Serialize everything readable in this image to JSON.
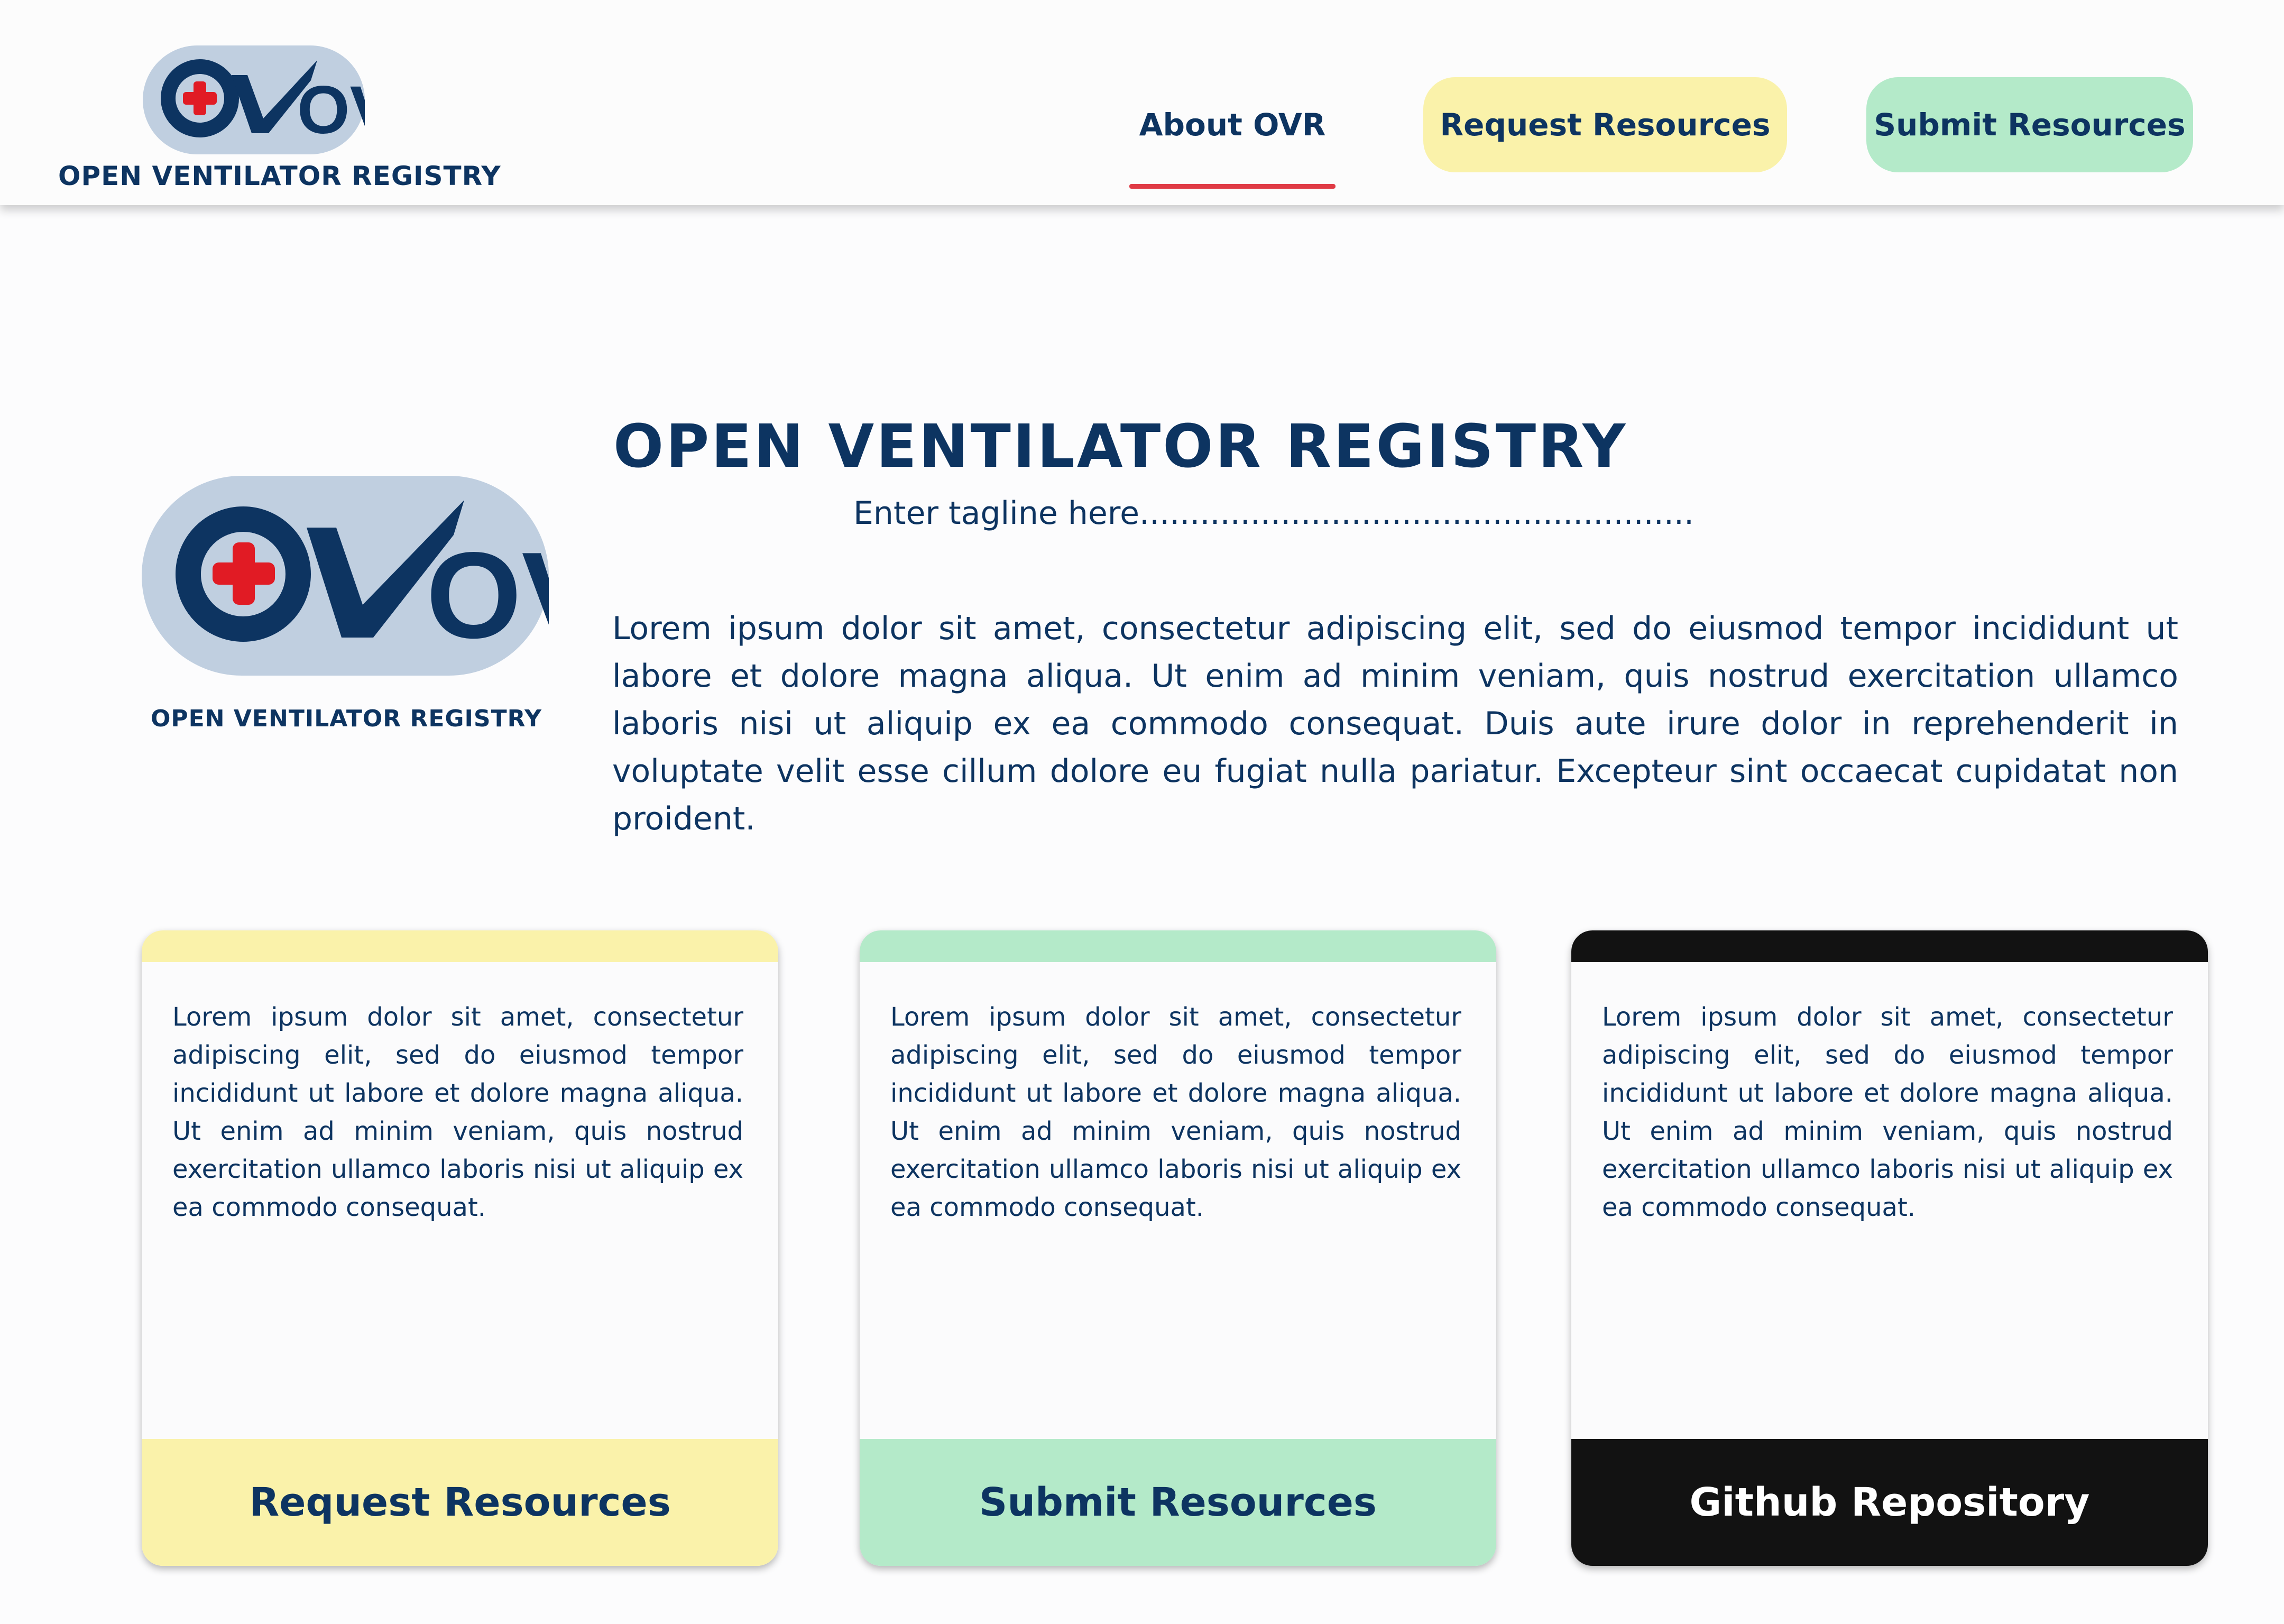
{
  "colors": {
    "navy": "#0d3461",
    "accent_red": "#e03b45",
    "logo_bg": "#c0cfe0",
    "request_yellow": "#faf2aa",
    "submit_green": "#b4eac9",
    "github_black": "#121212",
    "card_bg": "#fbfbfc"
  },
  "header": {
    "logo_text": "OVR",
    "logo_caption": "OPEN VENTILATOR REGISTRY",
    "nav": {
      "about": "About OVR",
      "request": "Request Resources",
      "submit": "Submit Resources"
    }
  },
  "hero": {
    "logo_text": "OVR",
    "logo_caption": "OPEN VENTILATOR REGISTRY",
    "title": "OPEN VENTILATOR REGISTRY",
    "tagline": "Enter tagline here.......................................................",
    "text": "Lorem ipsum dolor sit amet, consectetur adipiscing elit, sed do eiusmod tempor incididunt ut labore et dolore magna aliqua. Ut enim ad minim veniam, quis nostrud exercitation ullamco laboris nisi ut aliquip ex ea commodo consequat. Duis aute irure dolor in reprehenderit in voluptate velit esse cillum dolore eu fugiat nulla pariatur. Excepteur sint occaecat cupidatat non proident."
  },
  "cards": [
    {
      "text": "Lorem ipsum dolor sit amet, consectetur adipiscing elit, sed do eiusmod tempor incididunt ut labore et dolore magna aliqua. Ut enim ad minim veniam, quis nostrud exercitation ullamco laboris nisi ut aliquip ex ea commodo consequat.",
      "button": "Request Resources"
    },
    {
      "text": "Lorem ipsum dolor sit amet, consectetur adipiscing elit, sed do eiusmod tempor incididunt ut labore et dolore magna aliqua. Ut enim ad minim veniam, quis nostrud exercitation ullamco laboris nisi ut aliquip ex ea commodo consequat.",
      "button": "Submit Resources"
    },
    {
      "text": "Lorem ipsum dolor sit amet, consectetur adipiscing elit, sed do eiusmod tempor incididunt ut labore et dolore magna aliqua. Ut enim ad minim veniam, quis nostrud exercitation ullamco laboris nisi ut aliquip ex ea commodo consequat.",
      "button": "Github Repository"
    }
  ]
}
